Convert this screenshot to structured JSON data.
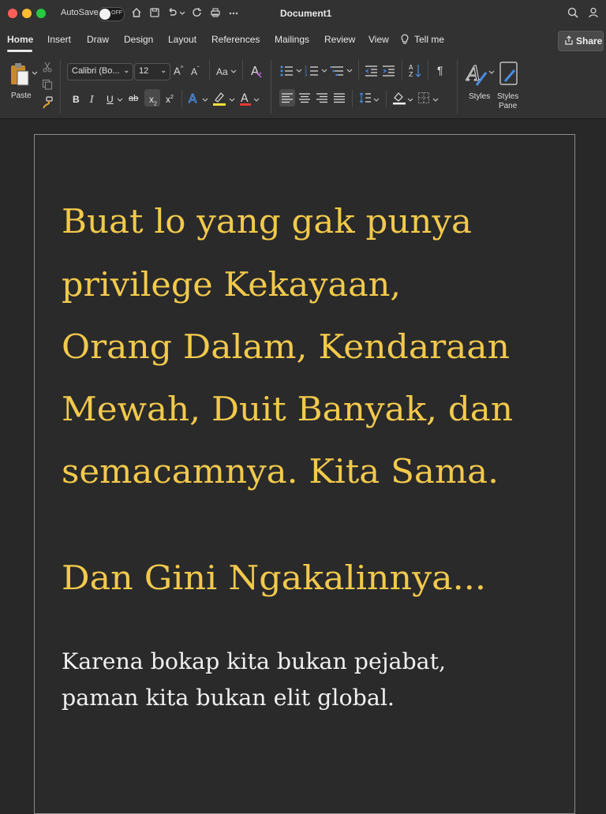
{
  "titlebar": {
    "autosave_label": "AutoSave",
    "autosave_state": "OFF",
    "document_title": "Document1"
  },
  "tabs": [
    {
      "label": "Home",
      "active": true
    },
    {
      "label": "Insert"
    },
    {
      "label": "Draw"
    },
    {
      "label": "Design"
    },
    {
      "label": "Layout"
    },
    {
      "label": "References"
    },
    {
      "label": "Mailings"
    },
    {
      "label": "Review"
    },
    {
      "label": "View"
    },
    {
      "label": "Tell me"
    }
  ],
  "share_label": "Share",
  "ribbon": {
    "paste_label": "Paste",
    "font_name": "Calibri (Bo...",
    "font_size": "12",
    "change_case": "Aa",
    "bold": "B",
    "italic": "I",
    "underline": "U",
    "strikethrough": "ab",
    "subscript": "x",
    "superscript": "x",
    "styles_label": "Styles",
    "styles_pane_label": "Styles\nPane"
  },
  "document": {
    "heading_lines": [
      "Buat lo yang gak punya",
      "privilege Kekayaan,",
      "Orang Dalam, Kendaraan",
      "Mewah, Duit Banyak, dan",
      "semacamnya. Kita Sama."
    ],
    "subheading": "Dan Gini Ngakalinnya...",
    "body_lines": [
      "Karena bokap kita bukan pejabat,",
      "paman kita bukan elit global."
    ]
  },
  "colors": {
    "heading": "#f2c94c",
    "body": "#f0f0f0",
    "background": "#282828"
  }
}
